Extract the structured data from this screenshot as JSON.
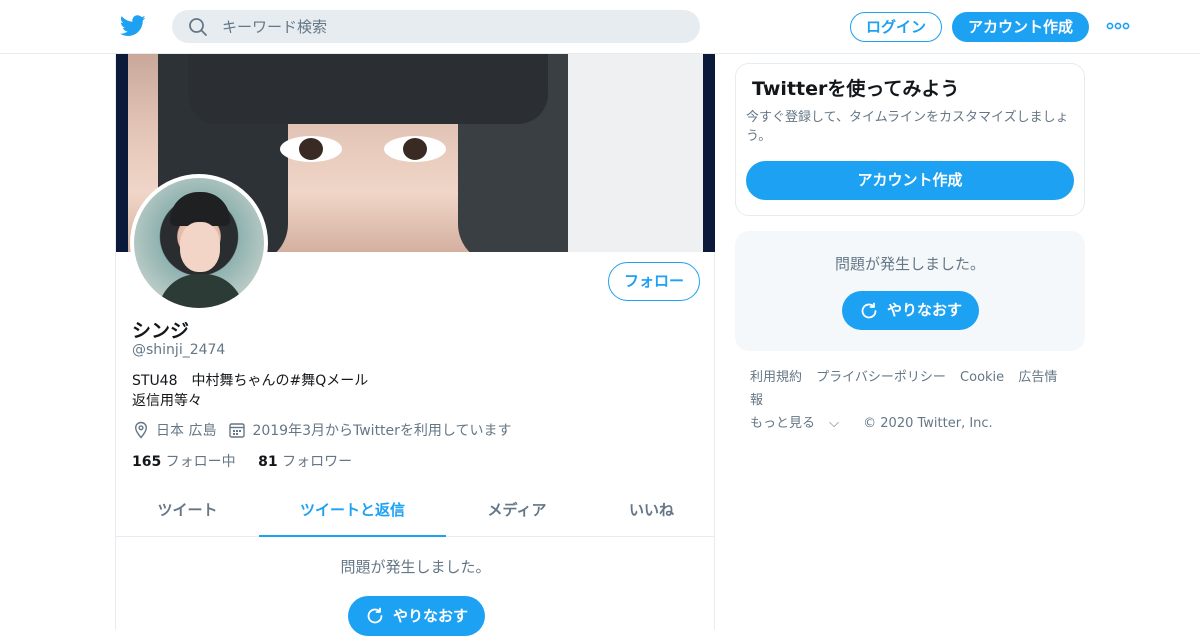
{
  "header": {
    "search_placeholder": "キーワード検索",
    "login_label": "ログイン",
    "signup_label": "アカウント作成"
  },
  "profile": {
    "name": "シンジ",
    "handle": "@shinji_2474",
    "bio_line1": "STU48　中村舞ちゃんの#舞Qメール",
    "bio_line2": "返信用等々",
    "location": "日本 広島",
    "joined": "2019年3月からTwitterを利用しています",
    "following_count": "165",
    "following_label": " フォロー中",
    "followers_count": "81",
    "followers_label": " フォロワー",
    "follow_label": "フォロー"
  },
  "tabs": [
    {
      "label": "ツイート"
    },
    {
      "label": "ツイートと返信"
    },
    {
      "label": "メディア"
    },
    {
      "label": "いいね"
    }
  ],
  "timeline": {
    "error_text": "問題が発生しました。",
    "retry_label": "やりなおす"
  },
  "sidebar": {
    "card_title": "Twitterを使ってみよう",
    "card_text": "今すぐ登録して、タイムラインをカスタマイズしましょう。",
    "card_button": "アカウント作成",
    "error_text": "問題が発生しました。",
    "retry_label": "やりなおす"
  },
  "footer": {
    "links": [
      "利用規約",
      "プライバシーポリシー",
      "Cookie",
      "広告情報"
    ],
    "more_label": "もっと見る",
    "copyright": "© 2020 Twitter, Inc."
  },
  "colors": {
    "accent": "#1da1f2",
    "muted": "#657786",
    "border": "#e6ecf0"
  }
}
